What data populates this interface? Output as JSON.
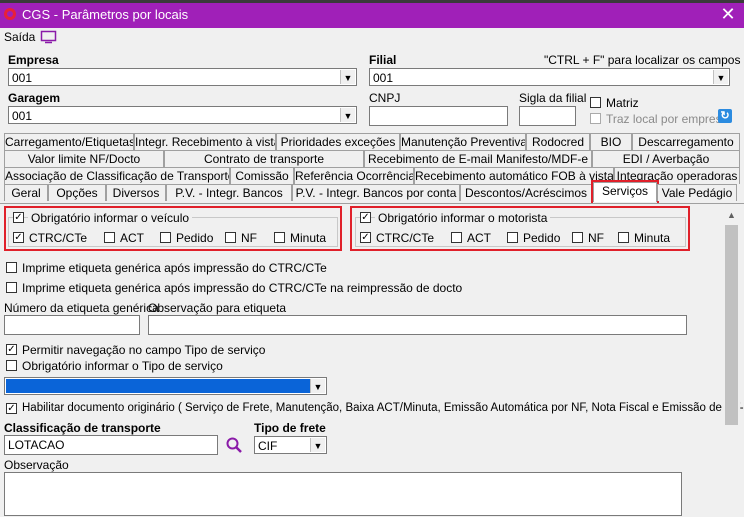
{
  "window": {
    "title": "CGS - Parâmetros por locais",
    "close_glyph": "✕"
  },
  "menu": {
    "saida": "Saída"
  },
  "fields": {
    "empresa_label": "Empresa",
    "empresa_value": "001",
    "filial_label": "Filial",
    "filial_value": "001",
    "hint": "\"CTRL + F\" para localizar os campos",
    "garagem_label": "Garagem",
    "garagem_value": "001",
    "cnpj_label": "CNPJ",
    "sigla_label": "Sigla da filial",
    "matriz_label": "Matriz",
    "traz_local_label": "Traz local por empresa"
  },
  "tabs": {
    "row1": [
      "Carregamento/Etiquetas",
      "Integr. Recebimento à vista",
      "Prioridades exceções",
      "Manutenção Preventiva",
      "Rodocred",
      "BIO",
      "Descarregamento"
    ],
    "row2": [
      "Valor limite NF/Docto",
      "Contrato de transporte",
      "Recebimento de E-mail Manifesto/MDF-e",
      "EDI / Averbação"
    ],
    "row3": [
      "Associação de Classificação de Transporte",
      "Comissão",
      "Referência Ocorrência",
      "Recebimento automático FOB à vista",
      "Integração operadoras"
    ],
    "row4": [
      "Geral",
      "Opções",
      "Diversos",
      "P.V. - Integr. Bancos",
      "P.V. - Integr. Bancos por conta",
      "Descontos/Acréscimos",
      "Serviços",
      "Vale Pedágio"
    ],
    "active": "Serviços"
  },
  "servicos": {
    "veiculo_group": {
      "title": "Obrigatório informar o veículo",
      "options": [
        "CTRC/CTe",
        "ACT",
        "Pedido",
        "NF",
        "Minuta"
      ]
    },
    "motorista_group": {
      "title": "Obrigatório informar o motorista",
      "options": [
        "CTRC/CTe",
        "ACT",
        "Pedido",
        "NF",
        "Minuta"
      ]
    },
    "imprime_1": "Imprime etiqueta genérica após impressão do CTRC/CTe",
    "imprime_2": "Imprime etiqueta genérica após impressão do CTRC/CTe na reimpressão de docto",
    "numero_etiqueta_label": "Número da etiqueta genérica",
    "observacao_etiqueta_label": "Observação para etiqueta",
    "permitir_navegacao": "Permitir navegação no campo Tipo de serviço",
    "obrigatorio_tipo_servico": "Obrigatório informar o Tipo de serviço",
    "habilitar_documento": "Habilitar documento originário ( Serviço de Frete, Manutenção, Baixa ACT/Minuta, Emissão Automática por NF, Nota Fiscal e Emissão de CT-e )",
    "classificacao_label": "Classificação de transporte",
    "classificacao_value": "LOTACAO",
    "tipo_frete_label": "Tipo de frete",
    "tipo_frete_value": "CIF",
    "observacao_label": "Observação"
  },
  "check_glyph": "✓",
  "colors": {
    "titlebar": "#a020b8",
    "highlight": "#e0202a",
    "selection": "#0a64d8"
  }
}
